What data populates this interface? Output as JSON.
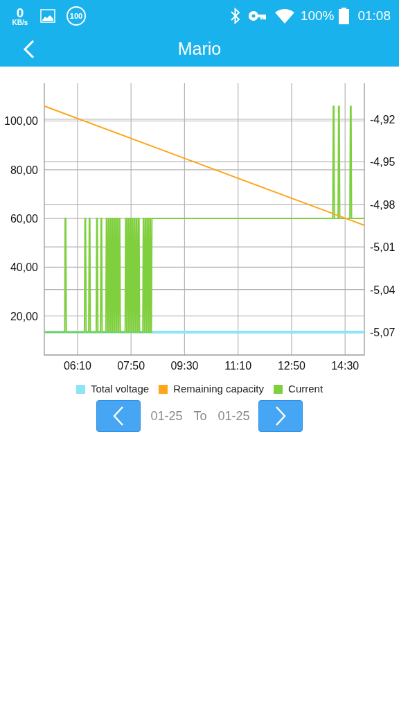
{
  "status_bar": {
    "net_speed": "0",
    "net_unit": "KB/s",
    "badge": "100",
    "battery": "100%",
    "time": "01:08"
  },
  "app_bar": {
    "title": "Mario"
  },
  "chart": {
    "chart_data": {
      "type": "line",
      "grid": true,
      "xlim": [
        308,
        906
      ],
      "ylim": [
        4,
        115.5
      ],
      "xticks": [
        {
          "value": 370,
          "label": "06:10"
        },
        {
          "value": 470,
          "label": "07:50"
        },
        {
          "value": 570,
          "label": "09:30"
        },
        {
          "value": 670,
          "label": "11:10"
        },
        {
          "value": 770,
          "label": "12:50"
        },
        {
          "value": 870,
          "label": "14:30"
        }
      ],
      "yticks": [
        {
          "value": 20,
          "label": "20,00"
        },
        {
          "value": 40,
          "label": "40,00"
        },
        {
          "value": 60,
          "label": "60,00"
        },
        {
          "value": 80,
          "label": "80,00"
        },
        {
          "value": 100,
          "label": "100,00"
        }
      ],
      "y2lim": [
        -5.0861,
        -4.8946
      ],
      "y2ticks": [
        {
          "value": -4.92,
          "label": "-4,92"
        },
        {
          "value": -4.95,
          "label": "-4,95"
        },
        {
          "value": -4.98,
          "label": "-4,98"
        },
        {
          "value": -5.01,
          "label": "-5,01"
        },
        {
          "value": -5.04,
          "label": "-5,04"
        },
        {
          "value": -5.07,
          "label": "-5,07"
        }
      ],
      "series": [
        {
          "name": "Total voltage",
          "color": "#8de4f7",
          "x": [
            308,
            906
          ],
          "values": [
            13.4,
            13.4
          ]
        },
        {
          "name": "Remaining capacity",
          "color": "#fea61a",
          "x": [
            308,
            906
          ],
          "values": [
            106.1,
            57.2
          ]
        },
        {
          "name": "Current",
          "color": "#7fcf3f",
          "x": [
            308,
            346,
            347,
            348,
            349,
            383,
            384,
            385,
            386,
            391,
            392,
            393,
            394,
            405,
            406,
            407,
            408,
            413,
            414,
            415,
            416,
            423,
            424,
            425,
            426,
            427,
            428,
            429,
            430,
            431,
            432,
            433,
            434,
            435,
            436,
            437,
            438,
            439,
            440,
            441,
            442,
            443,
            444,
            445,
            446,
            447,
            448,
            449,
            450,
            459,
            460,
            461,
            462,
            463,
            464,
            465,
            466,
            467,
            468,
            469,
            470,
            471,
            472,
            473,
            474,
            475,
            476,
            477,
            478,
            479,
            480,
            481,
            482,
            483,
            484,
            485,
            486,
            492,
            493,
            494,
            495,
            496,
            497,
            498,
            499,
            500,
            501,
            502,
            503,
            504,
            505,
            506,
            507,
            508,
            509,
            847,
            848,
            849,
            850,
            857,
            858,
            859,
            860,
            879,
            880,
            881,
            882,
            906
          ],
          "values": [
            13.4,
            13.4,
            60,
            60,
            13.4,
            13.4,
            60,
            60,
            13.4,
            13.4,
            60,
            60,
            13.4,
            13.4,
            60,
            60,
            13.4,
            13.4,
            60,
            60,
            13.4,
            13.4,
            60,
            60,
            13.4,
            13.4,
            60,
            60,
            13.4,
            13.4,
            60,
            60,
            13.4,
            13.4,
            60,
            60,
            13.4,
            13.4,
            60,
            60,
            13.4,
            13.4,
            60,
            60,
            13.4,
            13.4,
            60,
            60,
            13.4,
            13.4,
            60,
            60,
            13.4,
            13.4,
            60,
            60,
            13.4,
            13.4,
            60,
            60,
            13.4,
            13.4,
            60,
            60,
            13.4,
            13.4,
            60,
            60,
            13.4,
            13.4,
            60,
            60,
            13.4,
            13.4,
            60,
            60,
            13.4,
            13.4,
            60,
            60,
            13.4,
            13.4,
            60,
            60,
            13.4,
            13.4,
            60,
            60,
            13.4,
            13.4,
            60,
            60,
            13.4,
            13.4,
            60,
            60,
            106,
            106,
            60,
            60,
            106,
            106,
            60,
            60,
            106,
            106,
            60,
            60
          ]
        }
      ]
    }
  },
  "date_range": {
    "from": "01-25",
    "separator": "To",
    "to": "01-25"
  }
}
